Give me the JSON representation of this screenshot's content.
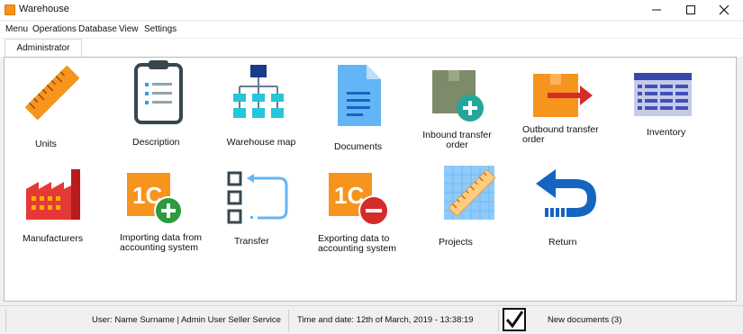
{
  "window": {
    "title": "Warehouse"
  },
  "menu": [
    "Menu",
    "Operations",
    "Database",
    "View",
    "Settings"
  ],
  "tabs": [
    "Administrator"
  ],
  "tiles": [
    {
      "label": "Units",
      "icon": "ruler-icon"
    },
    {
      "label": "Description",
      "icon": "clipboard-icon"
    },
    {
      "label": "Warehouse map",
      "icon": "hierarchy-icon"
    },
    {
      "label": "Documents",
      "icon": "document-icon"
    },
    {
      "label": "Inbound transfer order",
      "icon": "box-add-icon"
    },
    {
      "label": "Outbound transfer order",
      "icon": "box-arrow-icon"
    },
    {
      "label": "Inventory",
      "icon": "table-icon"
    },
    {
      "label": "Manufacturers",
      "icon": "factory-icon"
    },
    {
      "label": "Importing data from accounting system",
      "icon": "1c-import-icon"
    },
    {
      "label": "Transfer",
      "icon": "checklist-arrow-icon"
    },
    {
      "label": "Exporting data to accounting system",
      "icon": "1c-export-icon"
    },
    {
      "label": "Projects",
      "icon": "blueprint-ruler-icon"
    },
    {
      "label": "Return",
      "icon": "return-arrow-icon"
    }
  ],
  "status": {
    "user": "User: Name Surname | Admin User Seller Service",
    "datetime": "Time and date: 12th of March, 2019 - 13:38:19",
    "new_documents": "New documents (3)"
  },
  "colors": {
    "orange": "#f7941d",
    "blue": "#29a3dc",
    "green": "#2e9a3e",
    "red": "#d62b2b"
  }
}
